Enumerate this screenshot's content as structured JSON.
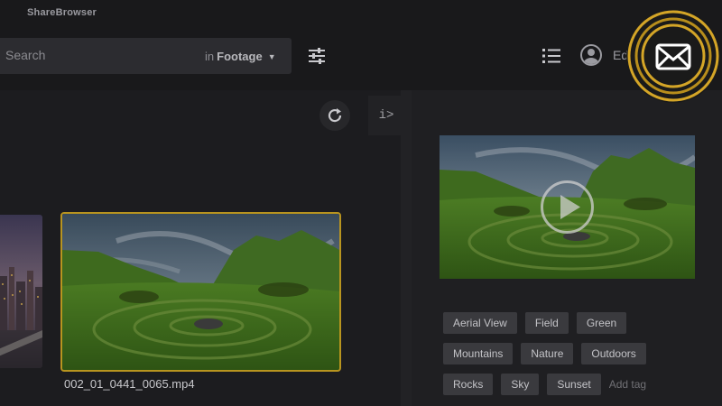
{
  "app": {
    "name": "ShareBrowser"
  },
  "search": {
    "placeholder": "Search",
    "scope_prefix": "in",
    "scope_value": "Footage"
  },
  "header": {
    "user_label": "Editor"
  },
  "assets": [
    {
      "name": "002_01_0441_0065.mp4",
      "selected": true
    }
  ],
  "tags": [
    [
      "Aerial View",
      "Field",
      "Green"
    ],
    [
      "Mountains",
      "Nature",
      "Outdoors"
    ],
    [
      "Rocks",
      "Sky",
      "Sunset"
    ]
  ],
  "add_tag_placeholder": "Add tag",
  "info_toggle_label": "i>",
  "colors": {
    "accent": "#b8941f",
    "badge_ring": "#d4a527"
  }
}
